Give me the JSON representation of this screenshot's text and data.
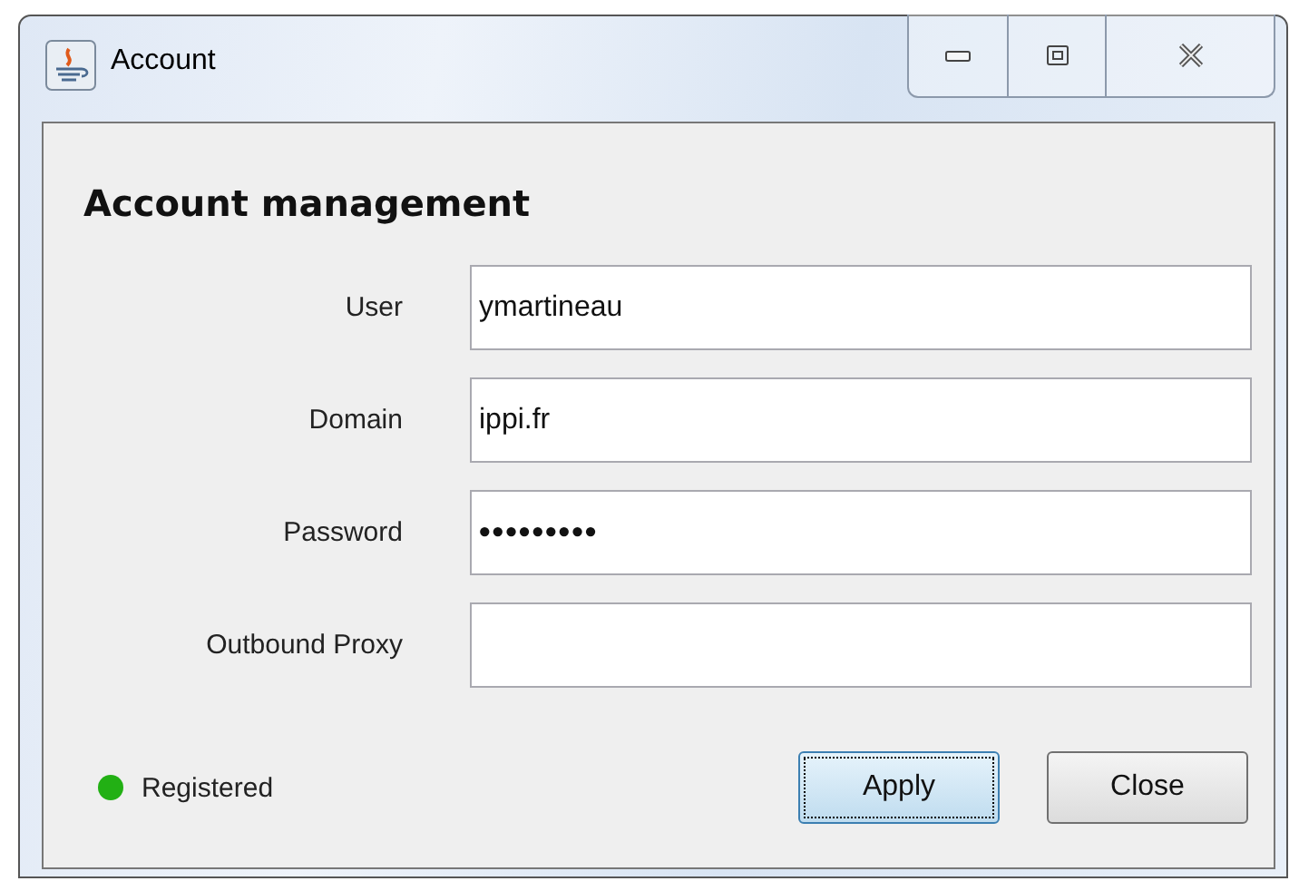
{
  "window": {
    "title": "Account",
    "controls": [
      {
        "kind": "minimize"
      },
      {
        "kind": "maximize"
      },
      {
        "kind": "close"
      }
    ]
  },
  "heading": "Account management",
  "fields": [
    {
      "label": "User",
      "value": "ymartineau"
    },
    {
      "label": "Domain",
      "value": "ippi.fr"
    },
    {
      "label": "Password",
      "value": "•••••••••"
    },
    {
      "label": "Outbound Proxy"
    }
  ],
  "status": {
    "text": "Registered",
    "color": "#22b014"
  },
  "buttons": [
    {
      "label": "Apply",
      "focused": true
    },
    {
      "label": "Close",
      "focused": false
    }
  ]
}
